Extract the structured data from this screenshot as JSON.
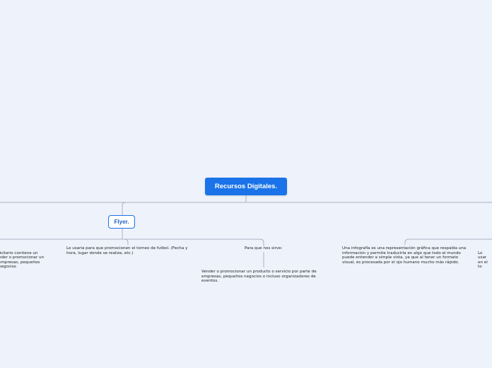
{
  "mindmap": {
    "root": {
      "label": "Recursos Digitales."
    },
    "branch": {
      "label": "Flyer."
    },
    "notes": {
      "left_partial": "licitario contiene un\nnder o promocionar un\nempresas, pequeños negocios\n.",
      "torneo": "Lo usaria para que promocionen el torneo de futbol. (Fecha y hora, lugar donde se realiza, etc.)",
      "para_que": "Para que nos sirve:",
      "vender": "Vender o promocionar un producto o servicio por parte de empresas, pequeños negocios o incluso organizadores de eventos.",
      "infografia": "Una infografía es una representación gráfica que respalda una información y permite traducirla en algo que todo el mundo puede entender a simple vista, ya que al tener un formato visual, es procesada por el ojo humano mucho más rápido.",
      "right_partial": "Lo usar\nen el to"
    },
    "colors": {
      "background": "#eef2fb",
      "root_fill": "#1a73e8",
      "branch_border": "#1a73e8",
      "connector": "#a9b3c2"
    }
  }
}
